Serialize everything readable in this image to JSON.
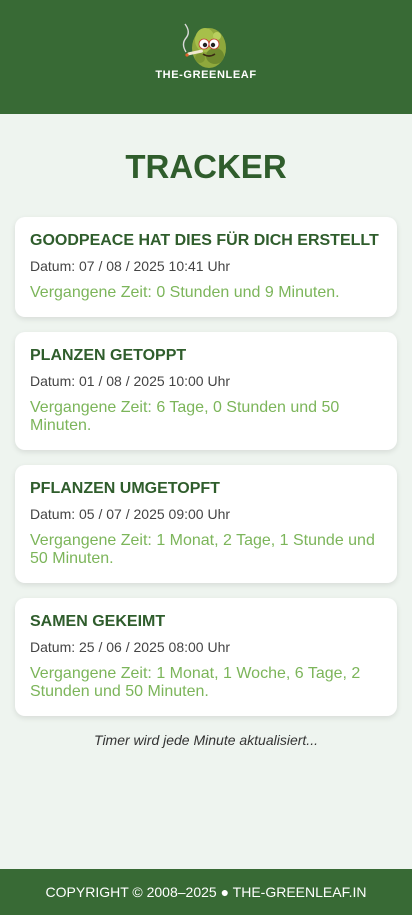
{
  "header": {
    "logo_text": "THE-GREENLEAF",
    "background": "#386a35"
  },
  "page": {
    "title": "TRACKER"
  },
  "entries": [
    {
      "title": "GOODPEACE HAT DIES FÜR DICH ERSTELLT",
      "date": "Datum: 07 / 08 / 2025 10:41 Uhr",
      "elapsed": "Vergangene Zeit: 0 Stunden und 9 Minuten."
    },
    {
      "title": "PLANZEN GETOPPT",
      "date": "Datum: 01 / 08 / 2025 10:00 Uhr",
      "elapsed": "Vergangene Zeit: 6 Tage, 0 Stunden und 50 Minuten."
    },
    {
      "title": "PFLANZEN UMGETOPFT",
      "date": "Datum: 05 / 07 / 2025 09:00 Uhr",
      "elapsed": "Vergangene Zeit: 1 Monat, 2 Tage, 1 Stunde und 50 Minuten."
    },
    {
      "title": "SAMEN GEKEIMT",
      "date": "Datum: 25 / 06 / 2025 08:00 Uhr",
      "elapsed": "Vergangene Zeit: 1 Monat, 1 Woche, 6 Tage, 2 Stunden und 50 Minuten."
    }
  ],
  "note": "Timer wird jede Minute aktualisiert...",
  "footer": {
    "text": "COPYRIGHT © 2008–2025 ● THE-GREENLEAF.IN"
  },
  "colors": {
    "accent_green": "#2f5d2c",
    "elapsed_green": "#7cb55a",
    "page_background": "#eef4ef"
  }
}
